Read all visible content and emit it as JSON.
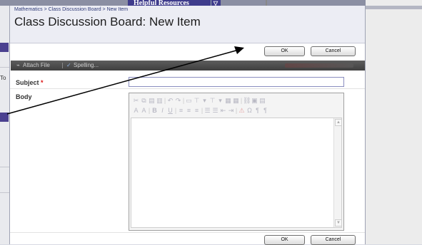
{
  "background": {
    "nav_tab_label": "Helpful Resources",
    "nav_tab_chevron": "▽",
    "left_fragment": "To"
  },
  "modal": {
    "breadcrumb": [
      "Mathematics",
      "Class Discussion Board",
      "New Item"
    ],
    "breadcrumb_separator": " > ",
    "title": "Class Discussion Board: New Item",
    "ok_label": "OK",
    "cancel_label": "Cancel"
  },
  "toolbar": {
    "attach_icon": "paperclip-icon",
    "attach_label": "Attach File",
    "spelling_icon": "spellcheck-icon",
    "spelling_label": "Spelling..."
  },
  "form": {
    "subject_label": "Subject",
    "required_mark": "*",
    "subject_value": "",
    "body_label": "Body"
  },
  "colors": {
    "header_bg": "#ecedf4",
    "toolbar_bg": "#4e4e4e",
    "nav_tab_bg": "#3f3c8c",
    "arrow": "#000000"
  }
}
